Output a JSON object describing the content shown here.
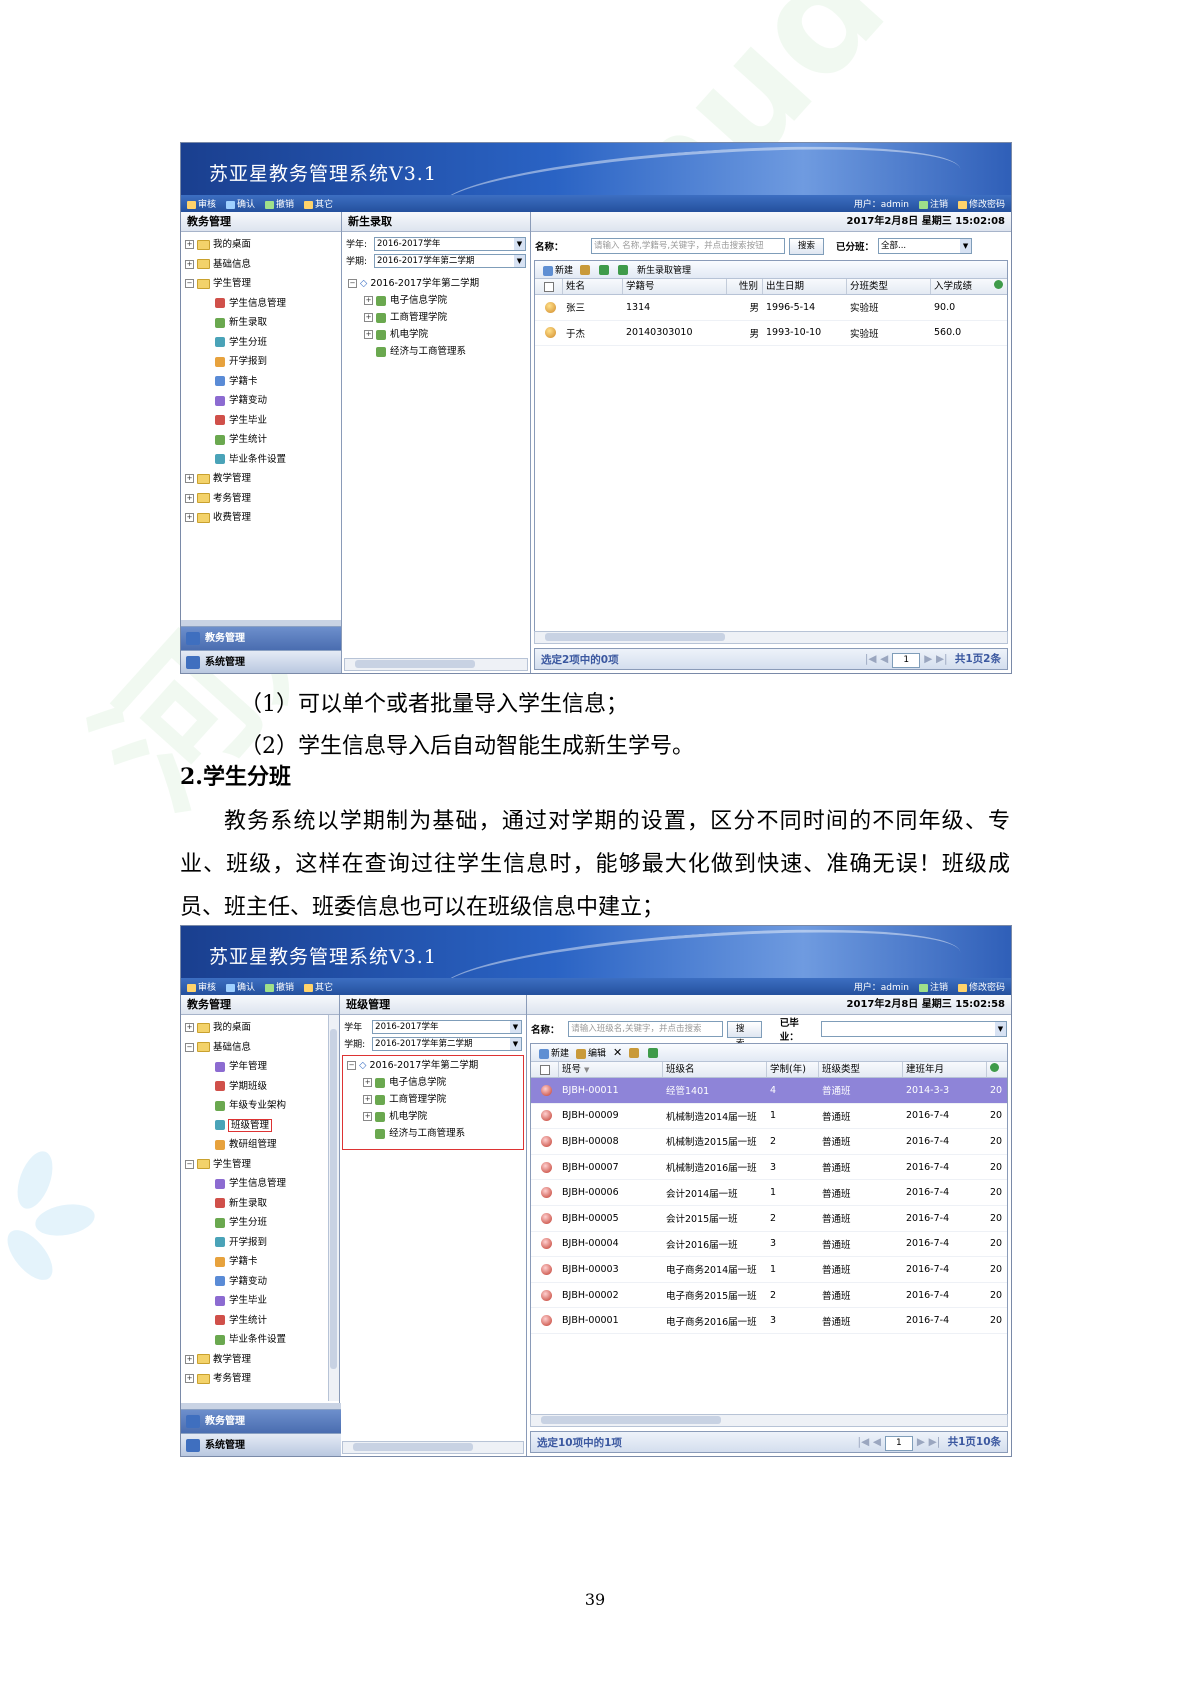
{
  "screenshot1": {
    "app_title": "苏亚星教务管理系统V3.1",
    "toolbar": [
      "审核",
      "确认",
      "撤销",
      "其它"
    ],
    "user": "用户：admin",
    "logout": "注销",
    "change_pwd": "修改密码",
    "left_title": "教务管理",
    "tree": [
      {
        "label": "我的桌面",
        "level": 0
      },
      {
        "label": "基础信息",
        "level": 0
      },
      {
        "label": "学生管理",
        "level": 0
      },
      {
        "label": "学生信息管理",
        "level": 1
      },
      {
        "label": "新生录取",
        "level": 1
      },
      {
        "label": "学生分班",
        "level": 1
      },
      {
        "label": "开学报到",
        "level": 1
      },
      {
        "label": "学籍卡",
        "level": 1
      },
      {
        "label": "学籍变动",
        "level": 1
      },
      {
        "label": "学生毕业",
        "level": 1
      },
      {
        "label": "学生统计",
        "level": 1
      },
      {
        "label": "毕业条件设置",
        "level": 1
      },
      {
        "label": "教学管理",
        "level": 0
      },
      {
        "label": "考务管理",
        "level": 0
      },
      {
        "label": "收费管理",
        "level": 0
      }
    ],
    "bottom_tabs": [
      "教务管理",
      "系统管理"
    ],
    "panel_title": "新生录取",
    "datetime": "2017年2月8日  星期三  15:02:08",
    "year_label": "学年:",
    "year_value": "2016-2017学年",
    "term_label": "学期:",
    "term_value": "2016-2017学年第二学期",
    "term_tree": [
      "2016-2017学年第二学期",
      "电子信息学院",
      "工商管理学院",
      "机电学院",
      "经济与工商管理系"
    ],
    "search_label": "名称：",
    "search_placeholder": "请输入 名称,学籍号,关键字，并点击搜索按钮",
    "search_button": "搜索",
    "class_label": "已分班：",
    "class_value": "全部...",
    "grid_toolbar": [
      "新建",
      "新生录取管理"
    ],
    "columns": [
      "姓名",
      "学籍号",
      "性别",
      "出生日期",
      "分班类型",
      "入学成绩"
    ],
    "rows": [
      [
        "张三",
        "1314",
        "男",
        "1996-5-14",
        "实验班",
        "90.0"
      ],
      [
        "于杰",
        "20140303010",
        "男",
        "1993-10-10",
        "实验班",
        "560.0"
      ]
    ],
    "footer_left": "选定2项中的0项",
    "page": "1",
    "footer_right": "共1页2条"
  },
  "text": {
    "item1": "（1）可以单个或者批量导入学生信息；",
    "item2": "（2）学生信息导入后自动智能生成新生学号。",
    "heading": "2.学生分班",
    "paragraph": "教务系统以学期制为基础，通过对学期的设置，区分不同时间的不同年级、专业、班级，这样在查询过往学生信息时，能够最大化做到快速、准确无误！班级成员、班主任、班委信息也可以在班级信息中建立；"
  },
  "screenshot2": {
    "app_title": "苏亚星教务管理系统V3.1",
    "toolbar": [
      "审核",
      "确认",
      "撤销",
      "其它"
    ],
    "user": "用户：admin",
    "logout": "注销",
    "change_pwd": "修改密码",
    "left_title": "教务管理",
    "tree": [
      {
        "label": "我的桌面",
        "level": 0
      },
      {
        "label": "基础信息",
        "level": 0
      },
      {
        "label": "学年管理",
        "level": 1
      },
      {
        "label": "学期班级",
        "level": 1
      },
      {
        "label": "年级专业架构",
        "level": 1
      },
      {
        "label": "班级管理",
        "level": 1,
        "selected": true
      },
      {
        "label": "教研组管理",
        "level": 1
      },
      {
        "label": "学生管理",
        "level": 0
      },
      {
        "label": "学生信息管理",
        "level": 1
      },
      {
        "label": "新生录取",
        "level": 1
      },
      {
        "label": "学生分班",
        "level": 1
      },
      {
        "label": "开学报到",
        "level": 1
      },
      {
        "label": "学籍卡",
        "level": 1
      },
      {
        "label": "学籍变动",
        "level": 1
      },
      {
        "label": "学生毕业",
        "level": 1
      },
      {
        "label": "学生统计",
        "level": 1
      },
      {
        "label": "毕业条件设置",
        "level": 1
      },
      {
        "label": "教学管理",
        "level": 0
      },
      {
        "label": "考务管理",
        "level": 0
      }
    ],
    "bottom_tabs": [
      "教务管理",
      "系统管理"
    ],
    "panel_title": "班级管理",
    "datetime": "2017年2月8日  星期三  15:02:58",
    "year_label": "学年",
    "year_value": "2016-2017学年",
    "term_label": "学期:",
    "term_value": "2016-2017学年第二学期",
    "term_tree": [
      "2016-2017学年第二学期",
      "电子信息学院",
      "工商管理学院",
      "机电学院",
      "经济与工商管理系"
    ],
    "search_label": "名称：",
    "search_placeholder": "请输入班级名,关键字，并点击搜索",
    "search_button": "搜索",
    "class_label": "已毕业：",
    "class_value": "",
    "grid_toolbar": [
      "新建",
      "编辑"
    ],
    "columns": [
      "班号",
      "班级名",
      "学制(年)",
      "班级类型",
      "建班年月",
      ""
    ],
    "rows": [
      [
        "BJBH-00011",
        "经管1401",
        "4",
        "普通班",
        "2014-3-3",
        "20"
      ],
      [
        "BJBH-00009",
        "机械制造2014届一班",
        "1",
        "普通班",
        "2016-7-4",
        "20"
      ],
      [
        "BJBH-00008",
        "机械制造2015届一班",
        "2",
        "普通班",
        "2016-7-4",
        "20"
      ],
      [
        "BJBH-00007",
        "机械制造2016届一班",
        "3",
        "普通班",
        "2016-7-4",
        "20"
      ],
      [
        "BJBH-00006",
        "会计2014届一班",
        "1",
        "普通班",
        "2016-7-4",
        "20"
      ],
      [
        "BJBH-00005",
        "会计2015届一班",
        "2",
        "普通班",
        "2016-7-4",
        "20"
      ],
      [
        "BJBH-00004",
        "会计2016届一班",
        "3",
        "普通班",
        "2016-7-4",
        "20"
      ],
      [
        "BJBH-00003",
        "电子商务2014届一班",
        "1",
        "普通班",
        "2016-7-4",
        "20"
      ],
      [
        "BJBH-00002",
        "电子商务2015届一班",
        "2",
        "普通班",
        "2016-7-4",
        "20"
      ],
      [
        "BJBH-00001",
        "电子商务2016届一班",
        "3",
        "普通班",
        "2016-7-4",
        "20"
      ]
    ],
    "highlight_row": 0,
    "footer_left": "选定10项中的1项",
    "page": "1",
    "footer_right": "共1页10条"
  },
  "page_number": "39",
  "watermark_text": "河姆渡 hemudo.com"
}
